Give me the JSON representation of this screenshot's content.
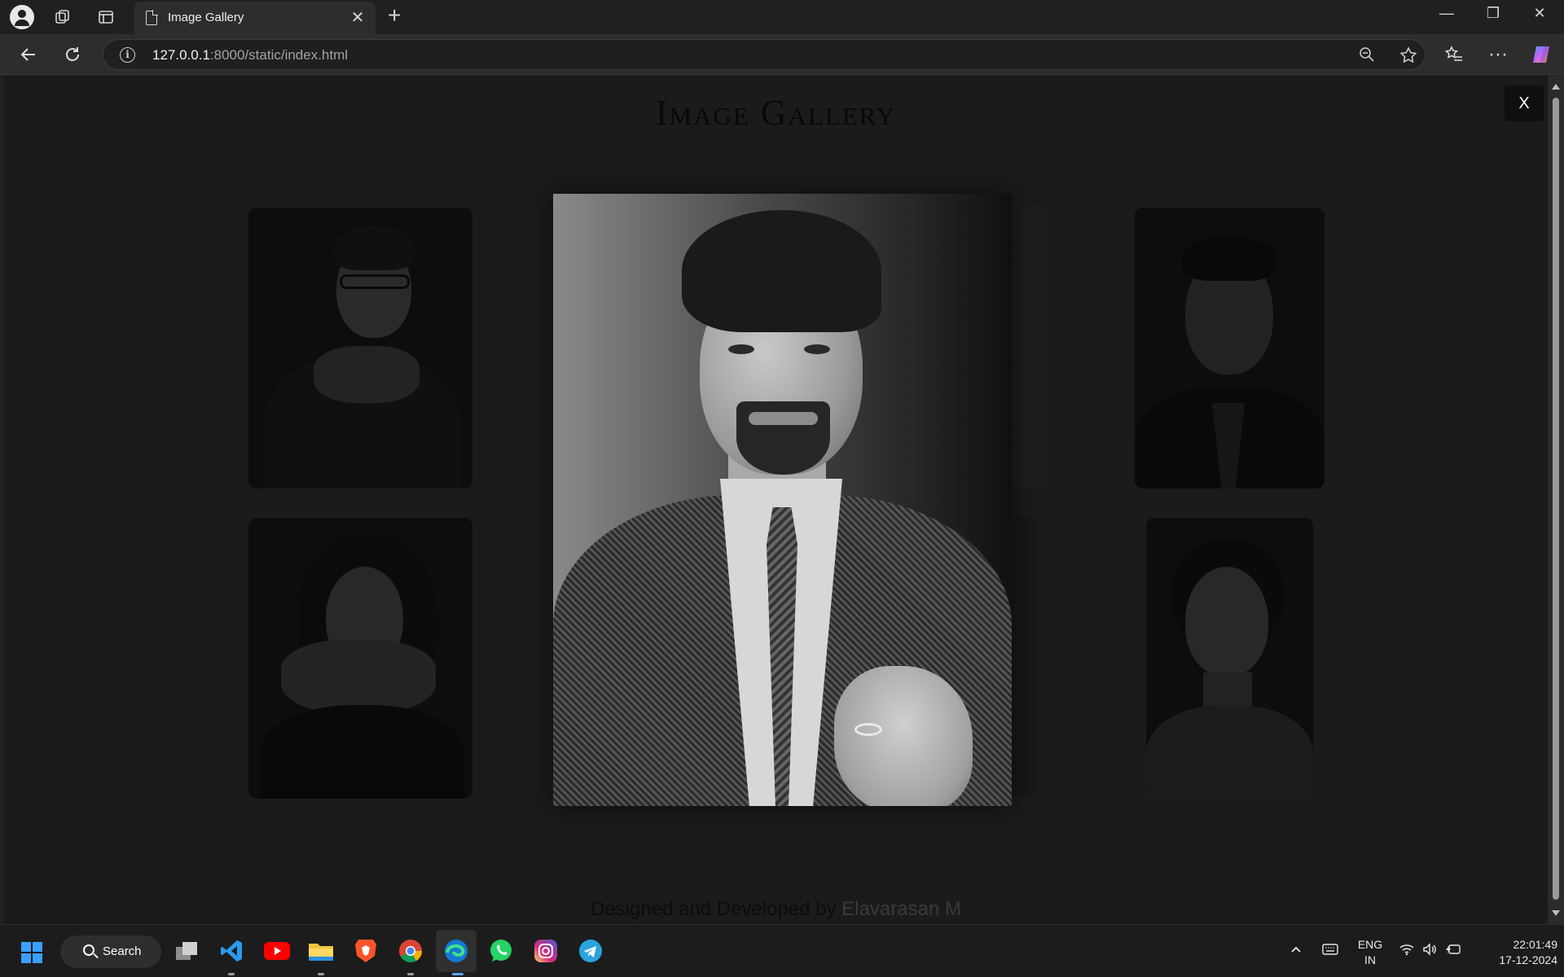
{
  "browser": {
    "tab_title": "Image Gallery",
    "url_host": "127.0.0.1",
    "url_path": ":8000/static/index.html"
  },
  "page": {
    "title": "Image Gallery",
    "close_label": "X",
    "footer_prefix": "Designed and Developed by ",
    "footer_author": "Elavarasan M"
  },
  "gallery": {
    "thumbnails": [
      {
        "name": "thumb-man-glasses"
      },
      {
        "name": "thumb-woman-hands-chin"
      },
      {
        "name": "thumb-man-suit-tie"
      },
      {
        "name": "thumb-woman-portrait"
      }
    ],
    "enlarged": {
      "name": "enlarged-man-suit-portrait"
    }
  },
  "taskbar": {
    "search_label": "Search",
    "lang_line1": "ENG",
    "lang_line2": "IN",
    "time": "22:01:49",
    "date": "17-12-2024",
    "apps": [
      "task-view",
      "vscode",
      "youtube",
      "file-explorer",
      "brave",
      "chrome",
      "edge",
      "whatsapp",
      "instagram",
      "telegram"
    ]
  },
  "colors": {
    "accent_blue": "#3aa0ff",
    "page_bg": "#1b1b1b"
  }
}
